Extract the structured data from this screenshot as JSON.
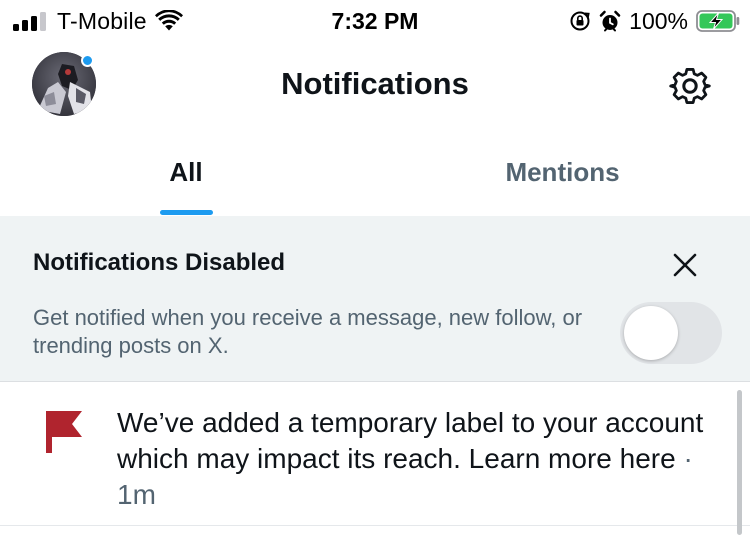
{
  "status_bar": {
    "carrier": "T-Mobile",
    "time": "7:32 PM",
    "battery_percent": "100%"
  },
  "header": {
    "title": "Notifications"
  },
  "tabs": [
    {
      "label": "All",
      "selected": true
    },
    {
      "label": "Mentions",
      "selected": false
    }
  ],
  "banner": {
    "title": "Notifications Disabled",
    "description": "Get notified when you receive a message, new follow, or trending posts on X.",
    "toggle_on": false
  },
  "notifications": [
    {
      "icon": "flag-icon",
      "text": "We’ve added a temporary label to your account which may impact its reach. Learn more here",
      "separator": "·",
      "time": "1m"
    }
  ],
  "colors": {
    "accent": "#1d9bf0",
    "flag": "#b0242e",
    "secondary_text": "#536471",
    "banner_bg": "#eff3f4",
    "battery_charging": "#34c759"
  }
}
